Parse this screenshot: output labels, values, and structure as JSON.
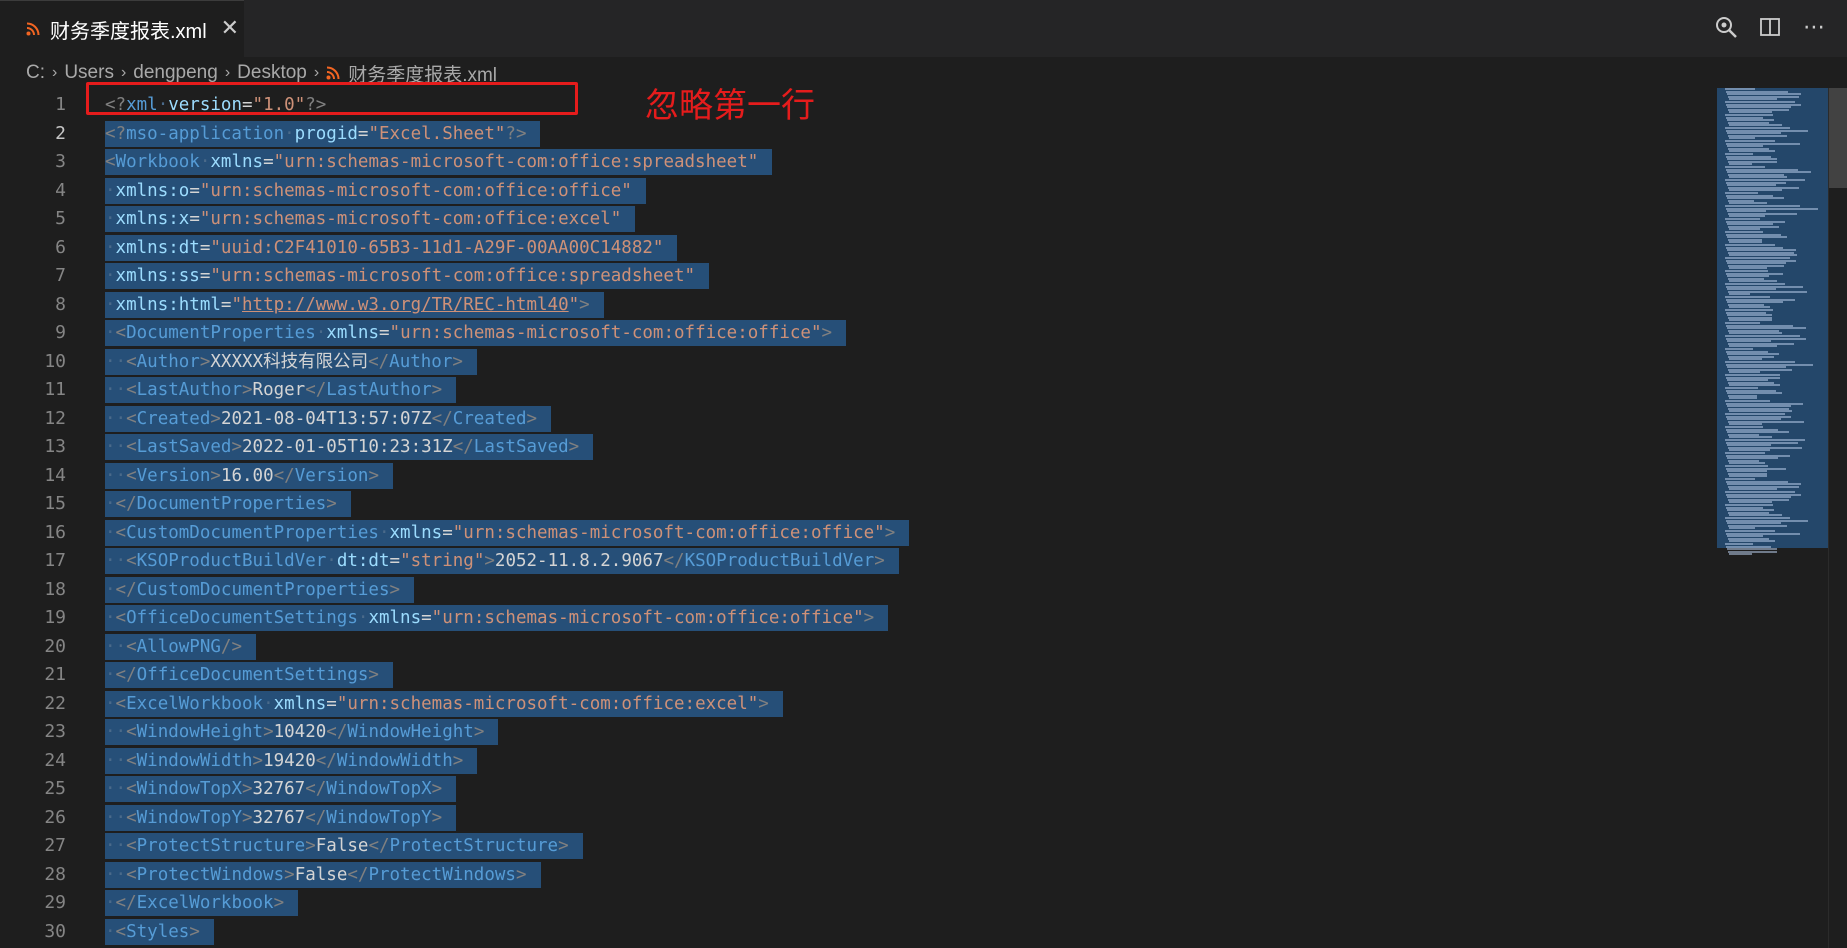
{
  "tab": {
    "title": "财务季度报表.xml",
    "close_label": "✕"
  },
  "actions": {
    "search": "search-icon",
    "split": "split-editor-icon",
    "more": "⋯"
  },
  "breadcrumb": {
    "items": [
      "C:",
      "Users",
      "dengpeng",
      "Desktop"
    ],
    "file": "财务季度报表.xml",
    "separator": "›"
  },
  "annotation": {
    "text": "忽略第一行",
    "color": "#e51c1c"
  },
  "colors": {
    "selection": "#264f78",
    "tag": "#569cd6",
    "attr": "#9cdcfe",
    "string": "#ce9178",
    "punctuation": "#808080",
    "text": "#d4d4d4",
    "rss": "#f26522"
  },
  "editor": {
    "active_line": 2,
    "lines": [
      {
        "n": "1",
        "sel": false,
        "tokens": [
          [
            "p",
            "<?"
          ],
          [
            "t",
            "xml"
          ],
          [
            "w",
            "·"
          ],
          [
            "a",
            "version"
          ],
          [
            "x",
            "="
          ],
          [
            "s",
            "\"1.0\""
          ],
          [
            "p",
            "?>"
          ]
        ]
      },
      {
        "n": "2",
        "sel": true,
        "tokens": [
          [
            "p",
            "<?"
          ],
          [
            "t",
            "mso-application"
          ],
          [
            "w",
            "·"
          ],
          [
            "a",
            "progid"
          ],
          [
            "x",
            "="
          ],
          [
            "s",
            "\"Excel.Sheet\""
          ],
          [
            "p",
            "?>"
          ]
        ]
      },
      {
        "n": "3",
        "sel": true,
        "tokens": [
          [
            "p",
            "<"
          ],
          [
            "t",
            "Workbook"
          ],
          [
            "w",
            "·"
          ],
          [
            "a",
            "xmlns"
          ],
          [
            "x",
            "="
          ],
          [
            "s",
            "\"urn:schemas-microsoft-com:office:spreadsheet\""
          ]
        ]
      },
      {
        "n": "4",
        "sel": true,
        "tokens": [
          [
            "w",
            "·"
          ],
          [
            "a",
            "xmlns:o"
          ],
          [
            "x",
            "="
          ],
          [
            "s",
            "\"urn:schemas-microsoft-com:office:office\""
          ]
        ]
      },
      {
        "n": "5",
        "sel": true,
        "tokens": [
          [
            "w",
            "·"
          ],
          [
            "a",
            "xmlns:x"
          ],
          [
            "x",
            "="
          ],
          [
            "s",
            "\"urn:schemas-microsoft-com:office:excel\""
          ]
        ]
      },
      {
        "n": "6",
        "sel": true,
        "tokens": [
          [
            "w",
            "·"
          ],
          [
            "a",
            "xmlns:dt"
          ],
          [
            "x",
            "="
          ],
          [
            "s",
            "\"uuid:C2F41010-65B3-11d1-A29F-00AA00C14882\""
          ]
        ]
      },
      {
        "n": "7",
        "sel": true,
        "tokens": [
          [
            "w",
            "·"
          ],
          [
            "a",
            "xmlns:ss"
          ],
          [
            "x",
            "="
          ],
          [
            "s",
            "\"urn:schemas-microsoft-com:office:spreadsheet\""
          ]
        ]
      },
      {
        "n": "8",
        "sel": true,
        "tokens": [
          [
            "w",
            "·"
          ],
          [
            "a",
            "xmlns:html"
          ],
          [
            "x",
            "="
          ],
          [
            "s",
            "\""
          ],
          [
            "u",
            "http://www.w3.org/TR/REC-html40"
          ],
          [
            "s",
            "\""
          ],
          [
            "p",
            ">"
          ]
        ]
      },
      {
        "n": "9",
        "sel": true,
        "tokens": [
          [
            "w",
            "·"
          ],
          [
            "p",
            "<"
          ],
          [
            "t",
            "DocumentProperties"
          ],
          [
            "w",
            "·"
          ],
          [
            "a",
            "xmlns"
          ],
          [
            "x",
            "="
          ],
          [
            "s",
            "\"urn:schemas-microsoft-com:office:office\""
          ],
          [
            "p",
            ">"
          ]
        ]
      },
      {
        "n": "10",
        "sel": true,
        "tokens": [
          [
            "w",
            "··"
          ],
          [
            "p",
            "<"
          ],
          [
            "t",
            "Author"
          ],
          [
            "p",
            ">"
          ],
          [
            "x",
            "XXXXX科技有限公司"
          ],
          [
            "p",
            "</"
          ],
          [
            "t",
            "Author"
          ],
          [
            "p",
            ">"
          ]
        ]
      },
      {
        "n": "11",
        "sel": true,
        "tokens": [
          [
            "w",
            "··"
          ],
          [
            "p",
            "<"
          ],
          [
            "t",
            "LastAuthor"
          ],
          [
            "p",
            ">"
          ],
          [
            "x",
            "Roger"
          ],
          [
            "p",
            "</"
          ],
          [
            "t",
            "LastAuthor"
          ],
          [
            "p",
            ">"
          ]
        ]
      },
      {
        "n": "12",
        "sel": true,
        "tokens": [
          [
            "w",
            "··"
          ],
          [
            "p",
            "<"
          ],
          [
            "t",
            "Created"
          ],
          [
            "p",
            ">"
          ],
          [
            "x",
            "2021-08-04T13:57:07Z"
          ],
          [
            "p",
            "</"
          ],
          [
            "t",
            "Created"
          ],
          [
            "p",
            ">"
          ]
        ]
      },
      {
        "n": "13",
        "sel": true,
        "tokens": [
          [
            "w",
            "··"
          ],
          [
            "p",
            "<"
          ],
          [
            "t",
            "LastSaved"
          ],
          [
            "p",
            ">"
          ],
          [
            "x",
            "2022-01-05T10:23:31Z"
          ],
          [
            "p",
            "</"
          ],
          [
            "t",
            "LastSaved"
          ],
          [
            "p",
            ">"
          ]
        ]
      },
      {
        "n": "14",
        "sel": true,
        "tokens": [
          [
            "w",
            "··"
          ],
          [
            "p",
            "<"
          ],
          [
            "t",
            "Version"
          ],
          [
            "p",
            ">"
          ],
          [
            "x",
            "16.00"
          ],
          [
            "p",
            "</"
          ],
          [
            "t",
            "Version"
          ],
          [
            "p",
            ">"
          ]
        ]
      },
      {
        "n": "15",
        "sel": true,
        "tokens": [
          [
            "w",
            "·"
          ],
          [
            "p",
            "</"
          ],
          [
            "t",
            "DocumentProperties"
          ],
          [
            "p",
            ">"
          ]
        ]
      },
      {
        "n": "16",
        "sel": true,
        "tokens": [
          [
            "w",
            "·"
          ],
          [
            "p",
            "<"
          ],
          [
            "t",
            "CustomDocumentProperties"
          ],
          [
            "w",
            "·"
          ],
          [
            "a",
            "xmlns"
          ],
          [
            "x",
            "="
          ],
          [
            "s",
            "\"urn:schemas-microsoft-com:office:office\""
          ],
          [
            "p",
            ">"
          ]
        ]
      },
      {
        "n": "17",
        "sel": true,
        "tokens": [
          [
            "w",
            "··"
          ],
          [
            "p",
            "<"
          ],
          [
            "t",
            "KSOProductBuildVer"
          ],
          [
            "w",
            "·"
          ],
          [
            "a",
            "dt:dt"
          ],
          [
            "x",
            "="
          ],
          [
            "s",
            "\"string\""
          ],
          [
            "p",
            ">"
          ],
          [
            "x",
            "2052-11.8.2.9067"
          ],
          [
            "p",
            "</"
          ],
          [
            "t",
            "KSOProductBuildVer"
          ],
          [
            "p",
            ">"
          ]
        ]
      },
      {
        "n": "18",
        "sel": true,
        "tokens": [
          [
            "w",
            "·"
          ],
          [
            "p",
            "</"
          ],
          [
            "t",
            "CustomDocumentProperties"
          ],
          [
            "p",
            ">"
          ]
        ]
      },
      {
        "n": "19",
        "sel": true,
        "tokens": [
          [
            "w",
            "·"
          ],
          [
            "p",
            "<"
          ],
          [
            "t",
            "OfficeDocumentSettings"
          ],
          [
            "w",
            "·"
          ],
          [
            "a",
            "xmlns"
          ],
          [
            "x",
            "="
          ],
          [
            "s",
            "\"urn:schemas-microsoft-com:office:office\""
          ],
          [
            "p",
            ">"
          ]
        ]
      },
      {
        "n": "20",
        "sel": true,
        "tokens": [
          [
            "w",
            "··"
          ],
          [
            "p",
            "<"
          ],
          [
            "t",
            "AllowPNG"
          ],
          [
            "p",
            "/>"
          ]
        ]
      },
      {
        "n": "21",
        "sel": true,
        "tokens": [
          [
            "w",
            "·"
          ],
          [
            "p",
            "</"
          ],
          [
            "t",
            "OfficeDocumentSettings"
          ],
          [
            "p",
            ">"
          ]
        ]
      },
      {
        "n": "22",
        "sel": true,
        "tokens": [
          [
            "w",
            "·"
          ],
          [
            "p",
            "<"
          ],
          [
            "t",
            "ExcelWorkbook"
          ],
          [
            "w",
            "·"
          ],
          [
            "a",
            "xmlns"
          ],
          [
            "x",
            "="
          ],
          [
            "s",
            "\"urn:schemas-microsoft-com:office:excel\""
          ],
          [
            "p",
            ">"
          ]
        ]
      },
      {
        "n": "23",
        "sel": true,
        "tokens": [
          [
            "w",
            "··"
          ],
          [
            "p",
            "<"
          ],
          [
            "t",
            "WindowHeight"
          ],
          [
            "p",
            ">"
          ],
          [
            "x",
            "10420"
          ],
          [
            "p",
            "</"
          ],
          [
            "t",
            "WindowHeight"
          ],
          [
            "p",
            ">"
          ]
        ]
      },
      {
        "n": "24",
        "sel": true,
        "tokens": [
          [
            "w",
            "··"
          ],
          [
            "p",
            "<"
          ],
          [
            "t",
            "WindowWidth"
          ],
          [
            "p",
            ">"
          ],
          [
            "x",
            "19420"
          ],
          [
            "p",
            "</"
          ],
          [
            "t",
            "WindowWidth"
          ],
          [
            "p",
            ">"
          ]
        ]
      },
      {
        "n": "25",
        "sel": true,
        "tokens": [
          [
            "w",
            "··"
          ],
          [
            "p",
            "<"
          ],
          [
            "t",
            "WindowTopX"
          ],
          [
            "p",
            ">"
          ],
          [
            "x",
            "32767"
          ],
          [
            "p",
            "</"
          ],
          [
            "t",
            "WindowTopX"
          ],
          [
            "p",
            ">"
          ]
        ]
      },
      {
        "n": "26",
        "sel": true,
        "tokens": [
          [
            "w",
            "··"
          ],
          [
            "p",
            "<"
          ],
          [
            "t",
            "WindowTopY"
          ],
          [
            "p",
            ">"
          ],
          [
            "x",
            "32767"
          ],
          [
            "p",
            "</"
          ],
          [
            "t",
            "WindowTopY"
          ],
          [
            "p",
            ">"
          ]
        ]
      },
      {
        "n": "27",
        "sel": true,
        "tokens": [
          [
            "w",
            "··"
          ],
          [
            "p",
            "<"
          ],
          [
            "t",
            "ProtectStructure"
          ],
          [
            "p",
            ">"
          ],
          [
            "x",
            "False"
          ],
          [
            "p",
            "</"
          ],
          [
            "t",
            "ProtectStructure"
          ],
          [
            "p",
            ">"
          ]
        ]
      },
      {
        "n": "28",
        "sel": true,
        "tokens": [
          [
            "w",
            "··"
          ],
          [
            "p",
            "<"
          ],
          [
            "t",
            "ProtectWindows"
          ],
          [
            "p",
            ">"
          ],
          [
            "x",
            "False"
          ],
          [
            "p",
            "</"
          ],
          [
            "t",
            "ProtectWindows"
          ],
          [
            "p",
            ">"
          ]
        ]
      },
      {
        "n": "29",
        "sel": true,
        "tokens": [
          [
            "w",
            "·"
          ],
          [
            "p",
            "</"
          ],
          [
            "t",
            "ExcelWorkbook"
          ],
          [
            "p",
            ">"
          ]
        ]
      },
      {
        "n": "30",
        "sel": true,
        "tokens": [
          [
            "w",
            "·"
          ],
          [
            "p",
            "<"
          ],
          [
            "t",
            "Styles"
          ],
          [
            "p",
            ">"
          ]
        ]
      }
    ]
  }
}
